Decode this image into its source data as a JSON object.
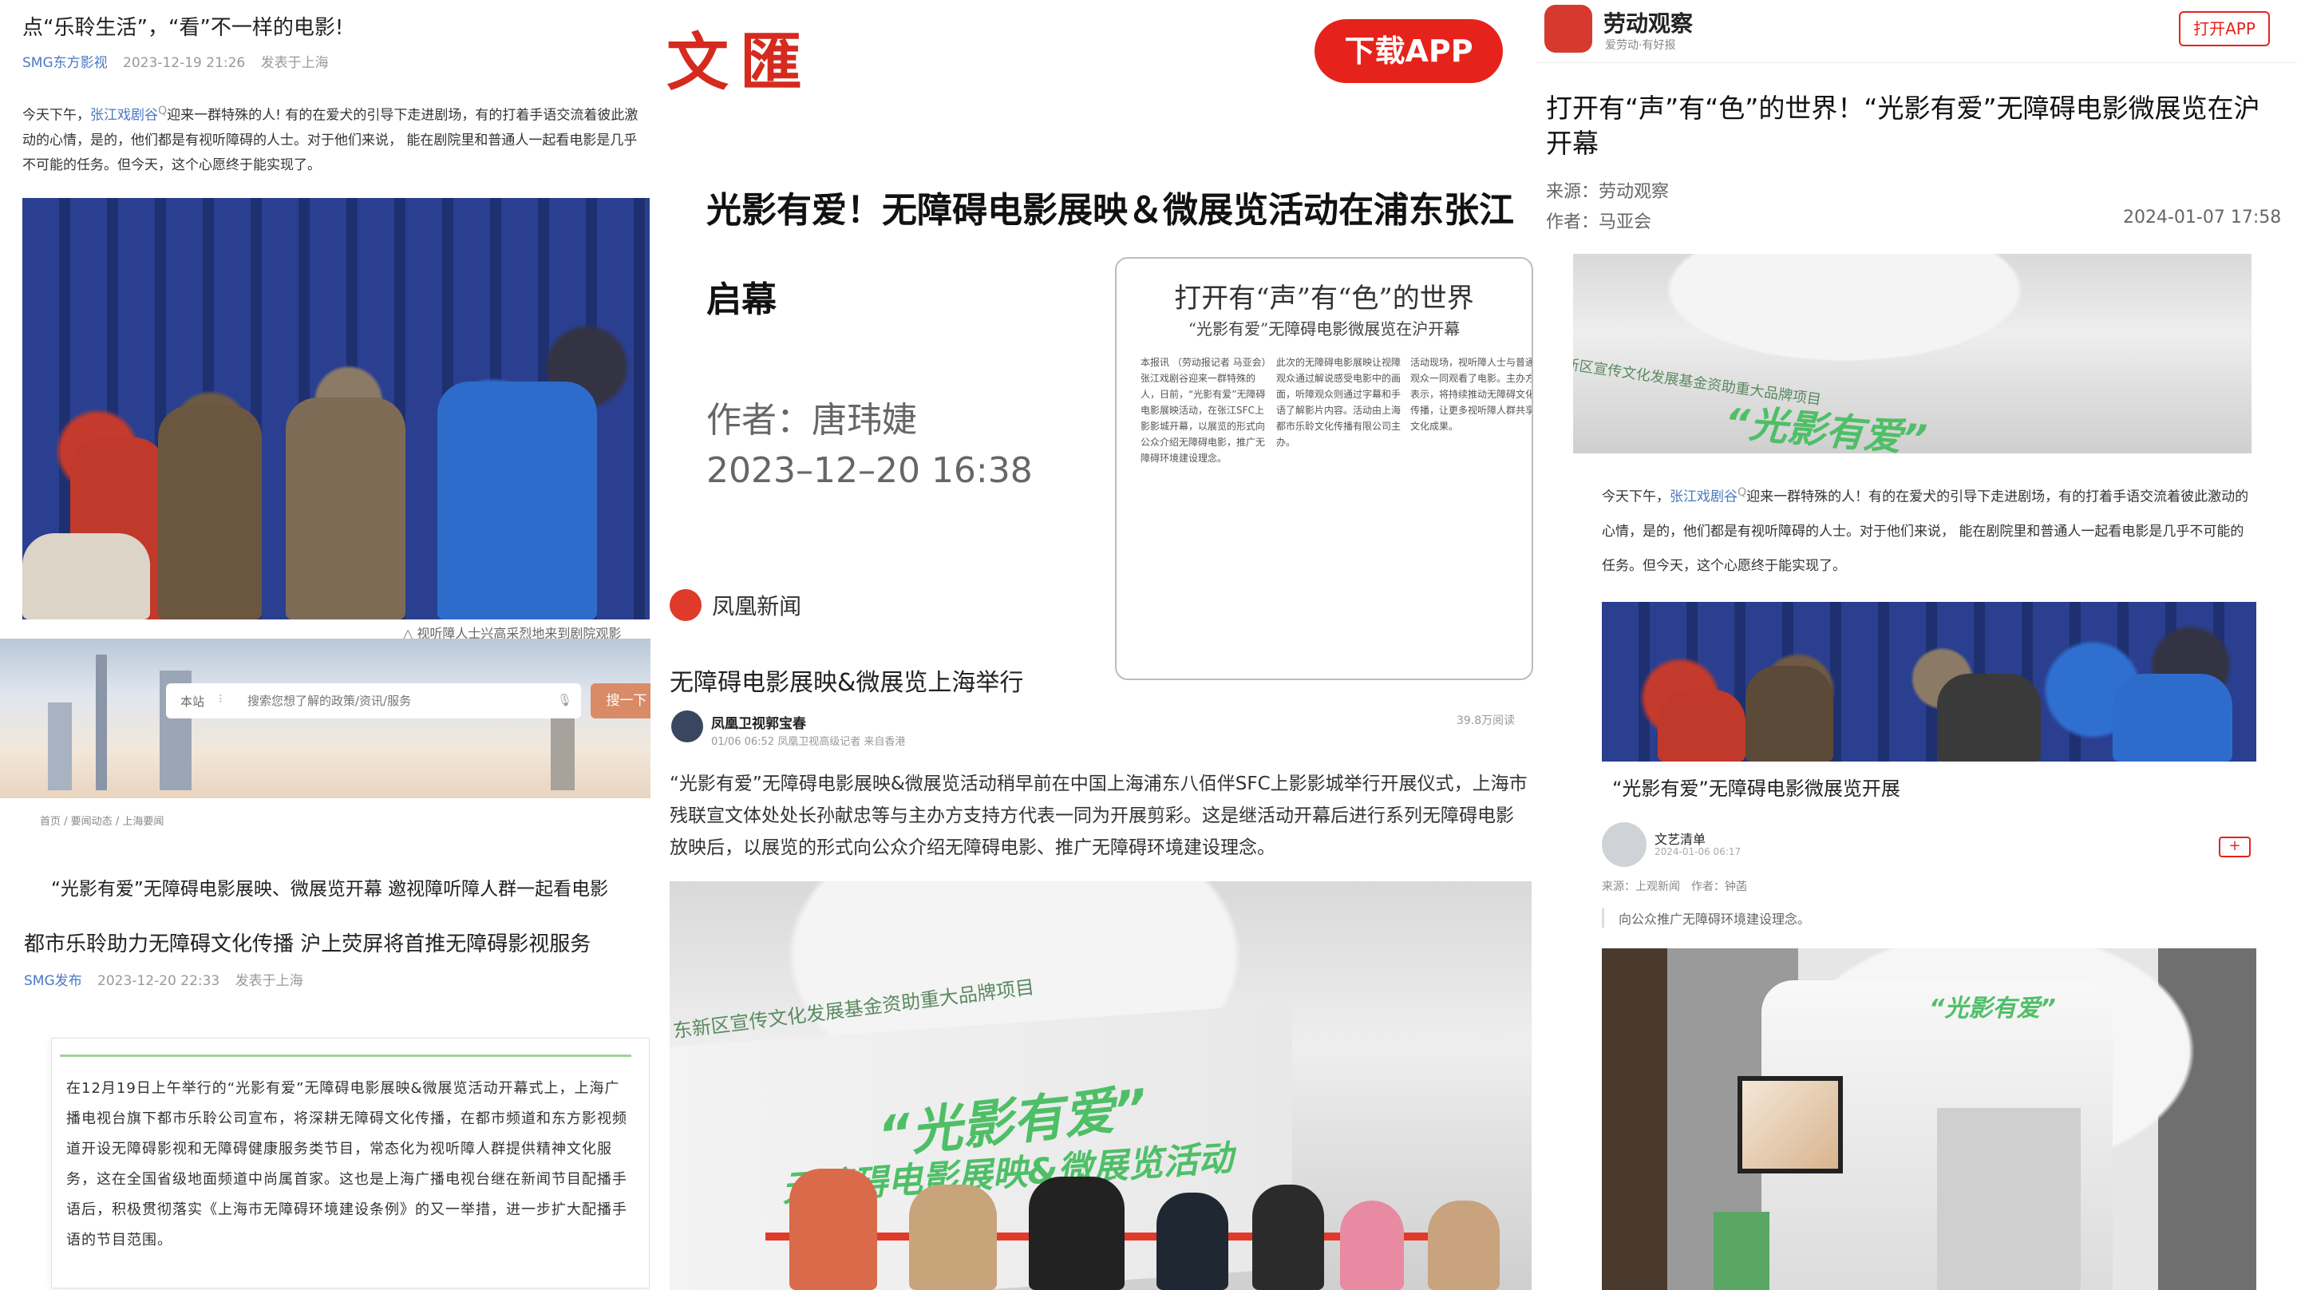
{
  "panel1": {
    "title": "点“乐聆生活”，“看”不一样的电影!",
    "source": "SMG东方影视",
    "time": "2023-12-19 21:26",
    "location": "发表于上海",
    "para_pre": "今天下午，",
    "para_link": "张江戏剧谷",
    "para_post": "迎来一群特殊的人! 有的在爱犬的引导下走进剧场，有的打着手语交流着彼此激动的心情，是的，他们都是有视听障碍的人士。对于他们来说， 能在剧院里和普通人一起看电影是几乎不可能的任务。但今天，这个心愿终于能实现了。",
    "caption": "△ 视听障人士兴高采烈地来到剧院观影"
  },
  "panel2": {
    "search_scope": "本站",
    "search_placeholder": "搜索您想了解的政策/资讯/服务",
    "search_button": "搜一下",
    "breadcrumb": [
      "首页",
      "要闻动态",
      "上海要闻"
    ],
    "headline": "“光影有爱”无障碍电影展映、微展览开幕 邀视障听障人群一起看电影",
    "title": "都市乐聆助力无障碍文化传播 沪上荧屏将首推无障碍影视服务",
    "source": "SMG发布",
    "time": "2023-12-20 22:33",
    "location": "发表于上海",
    "quote": "在12月19日上午举行的“光影有爱”无障碍电影展映&微展览活动开幕式上，上海广播电视台旗下都市乐聆公司宣布，将深耕无障碍文化传播，在都市频道和东方影视频道开设无障碍影视和无障碍健康服务类节目，常态化为视听障人群提供精神文化服务，这在全国省级地面频道中尚属首家。这也是上海广播电视台继在新闻节目配播手语后，积极贯彻落实《上海市无障碍环境建设条例》的又一举措，进一步扩大配播手语的节目范围。"
  },
  "panel3": {
    "logo": "文匯",
    "download_button": "下载APP",
    "title": "光影有爱！无障碍电影展映＆微展览活动在浦东张江启幕",
    "author": "作者：唐玮婕",
    "datetime": "2023–12–20 16:38",
    "newspaper": {
      "headline": "打开有“声”有“色”的世界",
      "subhead": "“光影有爱”无障碍电影微展览在沪开幕",
      "col1": "本报讯 （劳动报记者 马亚会）张江戏剧谷迎来一群特殊的人，日前，“光影有爱”无障碍电影展映活动，在张江SFC上影影城开幕，以展览的形式向公众介绍无障碍电影，推广无障碍环境建设理念。",
      "col2": "此次的无障碍电影展映让视障观众通过解说感受电影中的画面，听障观众则通过字幕和手语了解影片内容。活动由上海都市乐聆文化传播有限公司主办。",
      "col3": "活动现场，视听障人士与普通观众一同观看了电影。主办方表示，将持续推动无障碍文化传播，让更多视听障人群共享文化成果。"
    },
    "fenghuang": "凤凰新闻",
    "section_title": "无障碍电影展映&微展览上海举行",
    "reporter": "凤凰卫视郭宝春",
    "reporter_meta": "01/06 06:52  凤凰卫视高级记者  来自香港",
    "views": "39.8万阅读",
    "body": "“光影有爱”无障碍电影展映&微展览活动稍早前在中国上海浦东八佰伴SFC上影影城举行开展仪式，上海市残联宣文体处处长孙献忠等与主办方支持方代表一同为开展剪彩。这是继活动开幕后进行系列无障碍电影放映后，以展览的形式向公众介绍无障碍电影、推广无障碍环境建设理念。",
    "banner_small": "东新区宣传文化发展基金资助重大品牌项目",
    "banner_big": "“光影有爱”",
    "banner_sub": "无障碍电影展映&微展览活动"
  },
  "panel4": {
    "logo_text": "劳动观察",
    "logo_sub": "爱劳动·有好报",
    "open_button": "打开APP",
    "title": "打开有“声”有“色”的世界！“光影有爱”无障碍电影微展览在沪开幕",
    "source": "来源：劳动观察",
    "author": "作者：马亚会",
    "datetime": "2024-01-07 17:58",
    "banner_small": "新区宣传文化发展基金资助重大品牌项目",
    "banner_big": "“光影有爱”",
    "para_pre": "今天下午，",
    "para_link": "张江戏剧谷",
    "para_post": "迎来一群特殊的人！有的在爱犬的引导下走进剧场，有的打着手语交流着彼此激动的心情，是的，他们都是有视听障碍的人士。对于他们来说， 能在剧院里和普通人一起看电影是几乎不可能的任务。但今天，这个心愿终于能实现了。",
    "caption_title": "“光影有爱”无障碍电影微展览开展",
    "account": "文艺清单",
    "account_time": "2024-01-06 06:17",
    "meta": "来源：上观新闻　作者：钟菡",
    "quote": "向公众推广无障碍环境建设理念。",
    "booth_banner": "“光影有爱”"
  },
  "colors": {
    "red": "#e5231c",
    "blue_link": "#4a78c2",
    "green_banner": "#4fbf67"
  }
}
